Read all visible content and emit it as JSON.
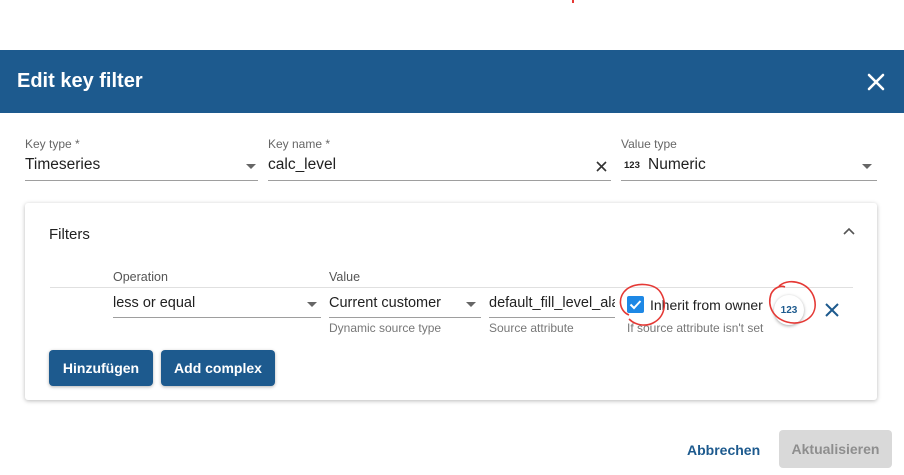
{
  "dialog": {
    "title": "Edit key filter",
    "key_type": {
      "label": "Key type *",
      "value": "Timeseries"
    },
    "key_name": {
      "label": "Key name *",
      "value": "calc_level"
    },
    "value_type": {
      "label": "Value type",
      "icon_text": "123",
      "value": "Numeric"
    },
    "filters": {
      "title": "Filters",
      "operation_header": "Operation",
      "value_header": "Value",
      "row": {
        "operation": "less or equal",
        "dynamic_source": "Current customer",
        "dynamic_source_label": "Dynamic source type",
        "source_attribute": "default_fill_level_alarm",
        "source_attribute_label": "Source attribute",
        "inherit_label": "Inherit from owner",
        "inherit_checked": true,
        "inherit_hint": "If source attribute isn't set",
        "numeric_badge": "123"
      },
      "add_button": "Hinzufügen",
      "add_complex_button": "Add complex"
    },
    "cancel_button": "Abbrechen",
    "update_button": "Aktualisieren"
  },
  "colors": {
    "header_bg": "#1d5a8e",
    "primary": "#1d5a8e",
    "checkbox": "#1e88e5",
    "annotation": "#e53935"
  }
}
